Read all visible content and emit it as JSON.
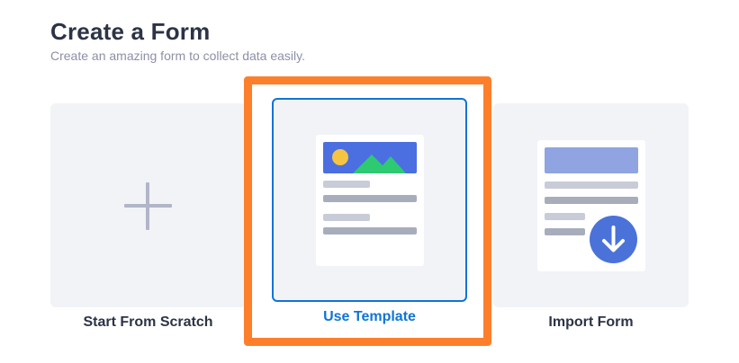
{
  "header": {
    "title": "Create a Form",
    "subtitle": "Create an amazing form to collect data easily."
  },
  "options": [
    {
      "label": "Start From Scratch",
      "icon": "plus-icon",
      "selected": false
    },
    {
      "label": "Use Template",
      "icon": "template-form-icon",
      "selected": true
    },
    {
      "label": "Import Form",
      "icon": "import-form-icon",
      "selected": false
    }
  ],
  "colors": {
    "title": "#2c3345",
    "subtitle": "#8d8fa8",
    "card_background": "#f2f3f7",
    "selected_border": "#0f74d7",
    "selected_label": "#0f74d7",
    "highlight": "#fd7f2c",
    "image_banner": "#4b6fe0",
    "download_circle": "#4b72d9"
  }
}
